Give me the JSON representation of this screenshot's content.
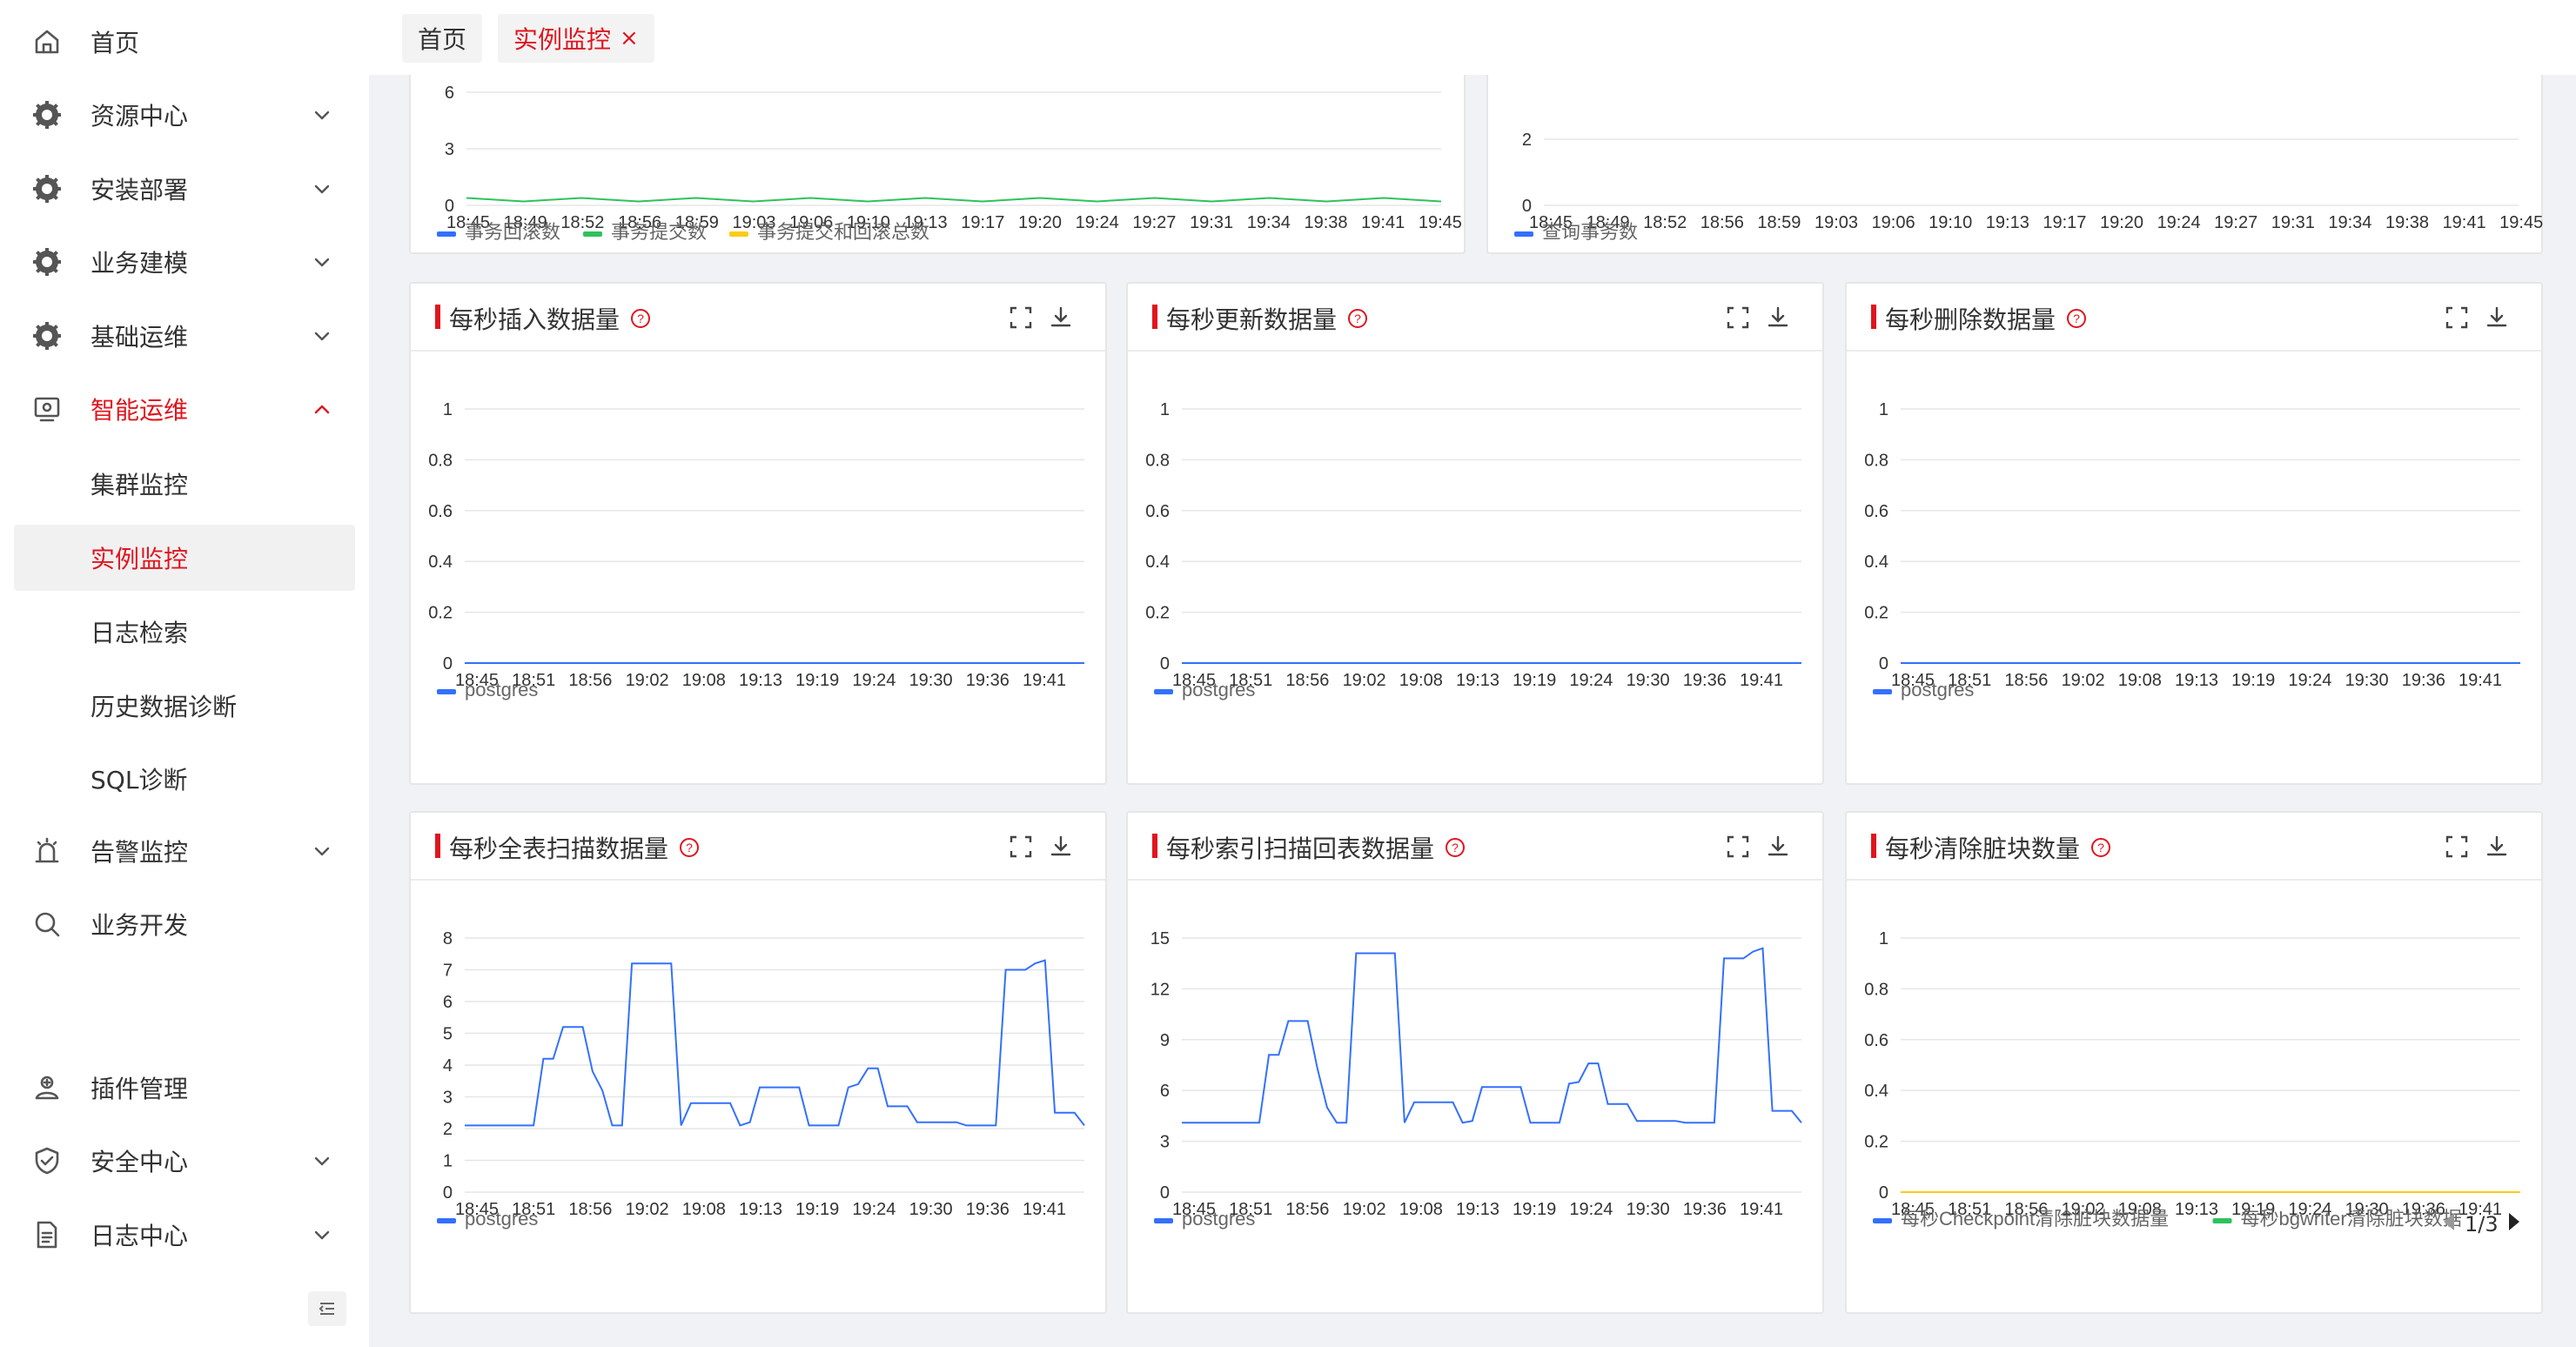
{
  "sidebar": {
    "items": [
      {
        "label": "首页",
        "icon": "home-icon",
        "has_chevron": false
      },
      {
        "label": "资源中心",
        "icon": "gear-icon",
        "has_chevron": true
      },
      {
        "label": "安装部署",
        "icon": "gear-icon",
        "has_chevron": true
      },
      {
        "label": "业务建模",
        "icon": "gear-icon",
        "has_chevron": true
      },
      {
        "label": "基础运维",
        "icon": "gear-icon",
        "has_chevron": true
      },
      {
        "label": "智能运维",
        "icon": "monitor-icon",
        "has_chevron": true,
        "expanded": true
      },
      {
        "label": "告警监控",
        "icon": "alarm-icon",
        "has_chevron": true
      },
      {
        "label": "业务开发",
        "icon": "search-icon",
        "has_chevron": false
      },
      {
        "label": "插件管理",
        "icon": "plugin-icon",
        "has_chevron": false
      },
      {
        "label": "安全中心",
        "icon": "shield-icon",
        "has_chevron": true
      },
      {
        "label": "日志中心",
        "icon": "document-icon",
        "has_chevron": true
      }
    ],
    "subitems": [
      {
        "label": "集群监控"
      },
      {
        "label": "实例监控",
        "selected": true
      },
      {
        "label": "日志检索"
      },
      {
        "label": "历史数据诊断"
      },
      {
        "label": "SQL诊断"
      }
    ]
  },
  "tabs": [
    {
      "label": "首页"
    },
    {
      "label": "实例监控",
      "active": true,
      "close": "×"
    }
  ],
  "colors": {
    "accent": "#e0151e",
    "series_blue": "#3370ff",
    "series_green": "#2fc25b",
    "series_yellow": "#facc14"
  },
  "pagination": {
    "text": "1/3"
  },
  "chart_data": [
    {
      "id": "top-left",
      "type": "line",
      "title": "",
      "x": [
        "18:45",
        "18:49",
        "18:52",
        "18:56",
        "18:59",
        "19:03",
        "19:06",
        "19:10",
        "19:13",
        "19:17",
        "19:20",
        "19:24",
        "19:27",
        "19:31",
        "19:34",
        "19:38",
        "19:41",
        "19:45"
      ],
      "yticks": [
        "0",
        "3",
        "6"
      ],
      "ylim": [
        0,
        6
      ],
      "series": [
        {
          "name": "事务回滚数",
          "color": "#3370ff",
          "values": []
        },
        {
          "name": "事务提交数",
          "color": "#2fc25b",
          "values": [
            0.3,
            0.3,
            0.3,
            0.3,
            0.3,
            0.3,
            0.3,
            0.3,
            0.3,
            0.3,
            0.3,
            0.3,
            0.3,
            0.3,
            0.3,
            0.3,
            0.3,
            0.3
          ]
        },
        {
          "name": "事务提交和回滚总数",
          "color": "#facc14",
          "values": []
        }
      ]
    },
    {
      "id": "top-right",
      "type": "line",
      "title": "",
      "x": [
        "18:45",
        "18:49",
        "18:52",
        "18:56",
        "18:59",
        "19:03",
        "19:06",
        "19:10",
        "19:13",
        "19:17",
        "19:20",
        "19:24",
        "19:27",
        "19:31",
        "19:34",
        "19:38",
        "19:41",
        "19:45"
      ],
      "yticks": [
        "0",
        "2"
      ],
      "ylim": [
        0,
        2
      ],
      "series": [
        {
          "name": "查询事务数",
          "color": "#3370ff",
          "values": []
        }
      ]
    },
    {
      "id": "insert",
      "type": "line",
      "title": "每秒插入数据量",
      "x": [
        "18:45",
        "18:51",
        "18:56",
        "19:02",
        "19:08",
        "19:13",
        "19:19",
        "19:24",
        "19:30",
        "19:36",
        "19:41"
      ],
      "yticks": [
        "0",
        "0.2",
        "0.4",
        "0.6",
        "0.8",
        "1"
      ],
      "ylim": [
        0,
        1
      ],
      "series": [
        {
          "name": "postgres",
          "color": "#3370ff",
          "values": [
            0,
            0,
            0,
            0,
            0,
            0,
            0,
            0,
            0,
            0,
            0
          ]
        }
      ]
    },
    {
      "id": "update",
      "type": "line",
      "title": "每秒更新数据量",
      "x": [
        "18:45",
        "18:51",
        "18:56",
        "19:02",
        "19:08",
        "19:13",
        "19:19",
        "19:24",
        "19:30",
        "19:36",
        "19:41"
      ],
      "yticks": [
        "0",
        "0.2",
        "0.4",
        "0.6",
        "0.8",
        "1"
      ],
      "ylim": [
        0,
        1
      ],
      "series": [
        {
          "name": "postgres",
          "color": "#3370ff",
          "values": [
            0,
            0,
            0,
            0,
            0,
            0,
            0,
            0,
            0,
            0,
            0
          ]
        }
      ]
    },
    {
      "id": "delete",
      "type": "line",
      "title": "每秒删除数据量",
      "x": [
        "18:45",
        "18:51",
        "18:56",
        "19:02",
        "19:08",
        "19:13",
        "19:19",
        "19:24",
        "19:30",
        "19:36",
        "19:41"
      ],
      "yticks": [
        "0",
        "0.2",
        "0.4",
        "0.6",
        "0.8",
        "1"
      ],
      "ylim": [
        0,
        1
      ],
      "series": [
        {
          "name": "postgres",
          "color": "#3370ff",
          "values": [
            0,
            0,
            0,
            0,
            0,
            0,
            0,
            0,
            0,
            0,
            0
          ]
        }
      ]
    },
    {
      "id": "fullscan",
      "type": "line",
      "title": "每秒全表扫描数据量",
      "x": [
        "18:45",
        "18:51",
        "18:56",
        "19:02",
        "19:08",
        "19:13",
        "19:19",
        "19:24",
        "19:30",
        "19:36",
        "19:41"
      ],
      "yticks": [
        "0",
        "1",
        "2",
        "3",
        "4",
        "5",
        "6",
        "7",
        "8"
      ],
      "ylim": [
        0,
        8
      ],
      "series": [
        {
          "name": "postgres",
          "color": "#3370ff",
          "values": [
            2.1,
            2.1,
            2.1,
            2.1,
            2.1,
            2.1,
            2.1,
            2.1,
            4.2,
            4.2,
            5.2,
            5.2,
            5.2,
            3.8,
            3.2,
            2.1,
            2.1,
            7.2,
            7.2,
            7.2,
            7.2,
            7.2,
            2.1,
            2.8,
            2.8,
            2.8,
            2.8,
            2.8,
            2.1,
            2.2,
            3.3,
            3.3,
            3.3,
            3.3,
            3.3,
            2.1,
            2.1,
            2.1,
            2.1,
            3.3,
            3.4,
            3.9,
            3.9,
            2.7,
            2.7,
            2.7,
            2.2,
            2.2,
            2.2,
            2.2,
            2.2,
            2.1,
            2.1,
            2.1,
            2.1,
            7.0,
            7.0,
            7.0,
            7.2,
            7.3,
            2.5,
            2.5,
            2.5,
            2.1
          ]
        }
      ]
    },
    {
      "id": "indexscan",
      "type": "line",
      "title": "每秒索引扫描回表数据量",
      "x": [
        "18:45",
        "18:51",
        "18:56",
        "19:02",
        "19:08",
        "19:13",
        "19:19",
        "19:24",
        "19:30",
        "19:36",
        "19:41"
      ],
      "yticks": [
        "0",
        "3",
        "6",
        "9",
        "12",
        "15"
      ],
      "ylim": [
        0,
        15
      ],
      "series": [
        {
          "name": "postgres",
          "color": "#3370ff",
          "values": [
            4.1,
            4.1,
            4.1,
            4.1,
            4.1,
            4.1,
            4.1,
            4.1,
            4.1,
            8.1,
            8.1,
            10.1,
            10.1,
            10.1,
            7.3,
            5.0,
            4.1,
            4.1,
            14.1,
            14.1,
            14.1,
            14.1,
            14.1,
            4.1,
            5.3,
            5.3,
            5.3,
            5.3,
            5.3,
            4.1,
            4.2,
            6.2,
            6.2,
            6.2,
            6.2,
            6.2,
            4.1,
            4.1,
            4.1,
            4.1,
            6.4,
            6.5,
            7.6,
            7.6,
            5.2,
            5.2,
            5.2,
            4.2,
            4.2,
            4.2,
            4.2,
            4.2,
            4.1,
            4.1,
            4.1,
            4.1,
            13.8,
            13.8,
            13.8,
            14.2,
            14.4,
            4.8,
            4.8,
            4.8,
            4.1
          ]
        }
      ]
    },
    {
      "id": "dirty",
      "type": "line",
      "title": "每秒清除脏块数量",
      "x": [
        "18:45",
        "18:51",
        "18:56",
        "19:02",
        "19:08",
        "19:13",
        "19:19",
        "19:24",
        "19:30",
        "19:36",
        "19:41"
      ],
      "yticks": [
        "0",
        "0.2",
        "0.4",
        "0.6",
        "0.8",
        "1"
      ],
      "ylim": [
        0,
        1
      ],
      "series": [
        {
          "name": "每秒Checkpoint清除脏块数据量",
          "color": "#3370ff",
          "values": [
            0,
            0,
            0,
            0,
            0,
            0,
            0,
            0,
            0,
            0,
            0
          ]
        },
        {
          "name": "每秒bgwriter清除脏块数据",
          "color": "#2fc25b",
          "values": [
            0,
            0,
            0,
            0,
            0,
            0,
            0,
            0,
            0,
            0,
            0
          ]
        },
        {
          "name": "",
          "color": "#facc14",
          "values": [
            0,
            0,
            0,
            0,
            0,
            0,
            0,
            0,
            0,
            0,
            0
          ]
        }
      ]
    }
  ]
}
